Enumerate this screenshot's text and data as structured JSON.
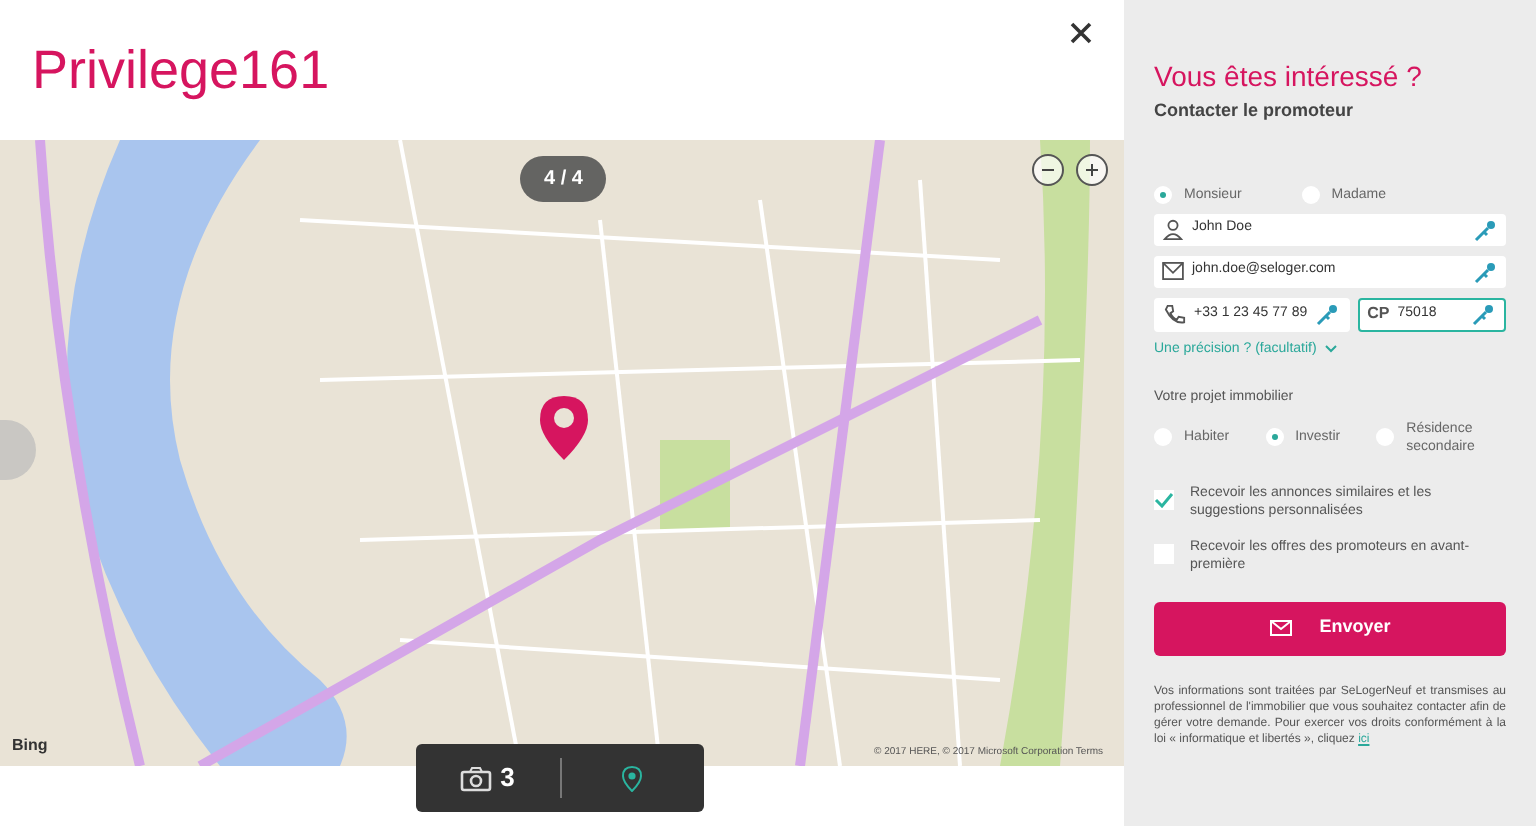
{
  "title": "Privilege161",
  "gallery": {
    "counter": "4 / 4",
    "photo_count": "3",
    "attribution": "© 2017 HERE, © 2017 Microsoft Corporation  Terms",
    "map_logo": "Bing"
  },
  "form": {
    "heading": "Vous êtes intéressé ?",
    "subheading": "Contacter le promoteur",
    "civility": [
      {
        "label": "Monsieur",
        "selected": true
      },
      {
        "label": "Madame",
        "selected": false
      }
    ],
    "fields": [
      {
        "kind": "person",
        "value": "John Doe"
      },
      {
        "kind": "mail",
        "value": "john.doe@seloger.com"
      }
    ],
    "half_fields": [
      {
        "kind": "phone",
        "value": "+33 1 23 45 77 89",
        "focused": false
      },
      {
        "kind": "postcode",
        "prefix": "CP",
        "value": "75018",
        "focused": true
      }
    ],
    "more_link": "Une précision ? (facultatif)",
    "project_label": "Votre projet immobilier",
    "project": [
      {
        "label": "Habiter",
        "selected": false
      },
      {
        "label": "Investir",
        "selected": true
      },
      {
        "label": "Résidence secondaire",
        "selected": false
      }
    ],
    "options": [
      {
        "label": "Recevoir les annonces similaires et les suggestions personnalisées",
        "checked": true
      },
      {
        "label": "Recevoir les offres des promoteurs en avant-première",
        "checked": false
      }
    ],
    "submit": "Envoyer",
    "disclaimer": "Vos informations sont traitées par SeLogerNeuf et transmises au professionnel de l'immobilier que vous souhaitez contacter afin de gérer votre demande. Pour exercer vos droits conformément à la loi « informatique et libertés », cliquez",
    "disclaimer_link": "ici"
  }
}
